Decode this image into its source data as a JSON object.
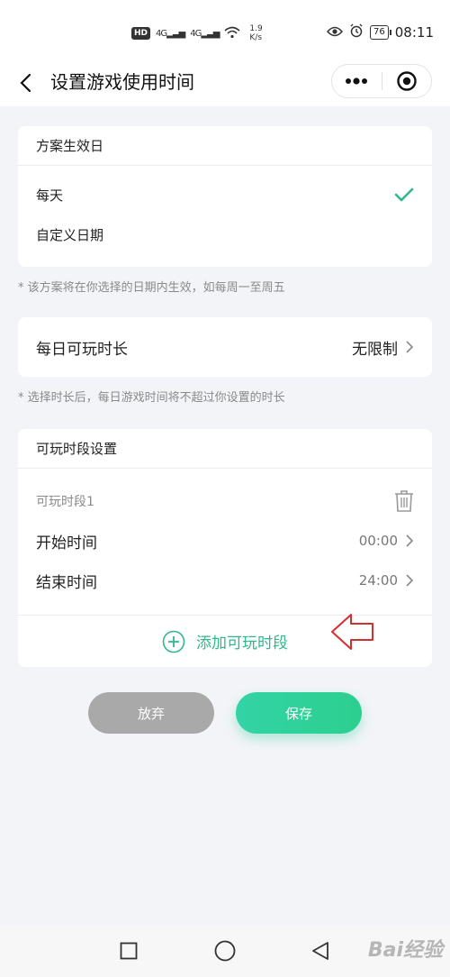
{
  "status_bar": {
    "hd": "HD",
    "signal1": "4G",
    "signal2": "4G",
    "speed_value": "1.9",
    "speed_unit": "K/s",
    "battery": "76",
    "time": "08:11"
  },
  "header": {
    "title": "设置游戏使用时间"
  },
  "effective_days": {
    "heading": "方案生效日",
    "options": [
      {
        "label": "每天",
        "selected": true
      },
      {
        "label": "自定义日期",
        "selected": false
      }
    ],
    "note": "* 该方案将在你选择的日期内生效，如每周一至周五"
  },
  "daily_limit": {
    "label": "每日可玩时长",
    "value": "无限制",
    "note": "* 选择时长后，每日游戏时间将不超过你设置的时长"
  },
  "periods": {
    "heading": "可玩时段设置",
    "period_title": "可玩时段1",
    "start_label": "开始时间",
    "start_value": "00:00",
    "end_label": "结束时间",
    "end_value": "24:00",
    "add_label": "添加可玩时段"
  },
  "buttons": {
    "abandon": "放弃",
    "save": "保存"
  },
  "watermark": "Bai经验",
  "colors": {
    "accent": "#2fb889",
    "save_button": "#33d3a5",
    "abandon_button": "#a9a9a9",
    "annotation_arrow": "#d32f2f"
  }
}
